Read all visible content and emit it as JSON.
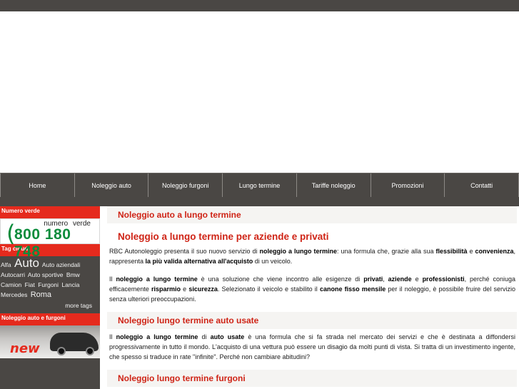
{
  "nav": {
    "items": [
      "Home",
      "Noleggio auto",
      "Noleggio furgoni",
      "Lungo termine",
      "Tariffe noleggio",
      "Promozioni",
      "Contatti"
    ]
  },
  "sidebar": {
    "numero_verde_heading": "Numero verde",
    "numero_verde_label": "numero verde",
    "numero_verde_number": "800 180 748",
    "tag_cloud_heading": "Tag cloud",
    "tags": [
      {
        "text": "Alfa",
        "size": "small"
      },
      {
        "text": "Auto",
        "size": "big"
      },
      {
        "text": "Auto aziendali",
        "size": "small"
      },
      {
        "text": "Autocarri",
        "size": "small"
      },
      {
        "text": "Auto sportive",
        "size": "small"
      },
      {
        "text": "Bmw",
        "size": "small"
      },
      {
        "text": "Camion",
        "size": "small"
      },
      {
        "text": "Fiat",
        "size": "small"
      },
      {
        "text": "Furgoni",
        "size": "small"
      },
      {
        "text": "Lancia",
        "size": "small"
      },
      {
        "text": "Mercedes",
        "size": "small"
      },
      {
        "text": "Roma",
        "size": "mid"
      }
    ],
    "more_tags": "more tags",
    "furgoni_heading": "Noleggio auto e furgoni",
    "banner_text": "new"
  },
  "main": {
    "title1": "Noleggio auto a lungo termine",
    "title2": "Noleggio a lungo termine per aziende e privati",
    "p1": [
      {
        "t": "RBC Autonoleggio presenta il suo nuovo servizio di "
      },
      {
        "t": "noleggio a lungo termine",
        "b": true
      },
      {
        "t": ": una formula che, grazie alla sua "
      },
      {
        "t": "flessibilità",
        "b": true
      },
      {
        "t": " e "
      },
      {
        "t": "convenienza",
        "b": true
      },
      {
        "t": ", rappresenta "
      },
      {
        "t": "la più valida alternativa all'acquisto",
        "b": true
      },
      {
        "t": " di un veicolo."
      }
    ],
    "p2": [
      {
        "t": "Il "
      },
      {
        "t": "noleggio a lungo termine",
        "b": true
      },
      {
        "t": " è una soluzione che viene incontro alle esigenze di "
      },
      {
        "t": "privati",
        "b": true
      },
      {
        "t": ", "
      },
      {
        "t": "aziende",
        "b": true
      },
      {
        "t": " e "
      },
      {
        "t": "professionisti",
        "b": true
      },
      {
        "t": ", perché coniuga efficacemente "
      },
      {
        "t": "risparmio",
        "b": true
      },
      {
        "t": " e "
      },
      {
        "t": "sicurezza",
        "b": true
      },
      {
        "t": ". Selezionato il veicolo e stabilito il "
      },
      {
        "t": "canone fisso mensile",
        "b": true
      },
      {
        "t": " per il noleggio, è possibile fruire del servizio senza ulteriori preoccupazioni."
      }
    ],
    "title3": "Noleggio lungo termine auto usate",
    "p3": [
      {
        "t": "Il "
      },
      {
        "t": "noleggio a lungo termine",
        "b": true
      },
      {
        "t": " di "
      },
      {
        "t": "auto usate",
        "b": true
      },
      {
        "t": " è una formula che si fa strada nel mercato dei servizi e che è destinata a diffondersi progressivamente in tutto il mondo. L'acquisto di una vettura può essere un disagio da molti punti di vista. Si tratta di un investimento ingente, che spesso si traduce in rate \"infinite\". Perché non cambiare abitudini?"
      }
    ],
    "title4": "Noleggio lungo termine furgoni"
  },
  "colors": {
    "dark_band": "#4a4744",
    "accent_red": "#e52a1d",
    "title_red": "#cf2416",
    "numero_green": "#0c8c3c"
  }
}
